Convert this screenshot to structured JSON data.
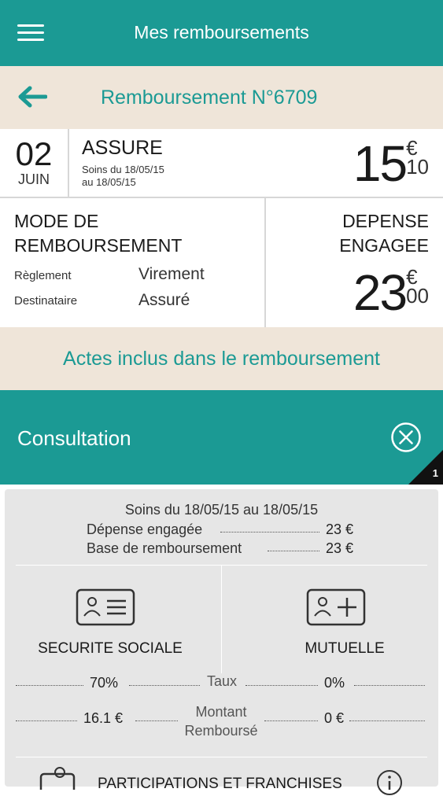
{
  "header": {
    "title": "Mes remboursements",
    "menu_icon": "menu-icon"
  },
  "subheader": {
    "title": "Remboursement N°6709",
    "back_icon": "back-arrow-icon"
  },
  "summary": {
    "day": "02",
    "month": "JUIN",
    "beneficiary": "ASSURE",
    "care_line1": "Soins du 18/05/15",
    "care_line2": "au 18/05/15",
    "amount_int": "15",
    "amount_currency": "€",
    "amount_dec": "10"
  },
  "mode": {
    "title_line1": "MODE DE",
    "title_line2": "REMBOURSEMENT",
    "reglement_label": "Règlement",
    "reglement_value": "Virement",
    "destinataire_label": "Destinataire",
    "destinataire_value": "Assuré"
  },
  "depense": {
    "title_line1": "DEPENSE",
    "title_line2": "ENGAGEE",
    "amount_int": "23",
    "amount_currency": "€",
    "amount_dec": "00"
  },
  "actes_title": "Actes inclus dans le remboursement",
  "consultation": {
    "title": "Consultation",
    "count": "1",
    "soins": "Soins du 18/05/15 au 18/05/15",
    "depense_label": "Dépense engagée",
    "depense_value": "23 €",
    "base_label": "Base de remboursement",
    "base_value": "23 €",
    "secu_title": "SECURITE SOCIALE",
    "mutuelle_title": "MUTUELLE",
    "taux_label": "Taux",
    "taux_secu": "70%",
    "taux_mutuelle": "0%",
    "montant_label1": "Montant",
    "montant_label2": "Remboursé",
    "montant_secu": "16.1 €",
    "montant_mutuelle": "0 €",
    "participations": "PARTICIPATIONS ET FRANCHISES"
  },
  "colors": {
    "teal": "#1b9a94",
    "beige": "#efe5d9",
    "card": "#e6e6e6"
  }
}
